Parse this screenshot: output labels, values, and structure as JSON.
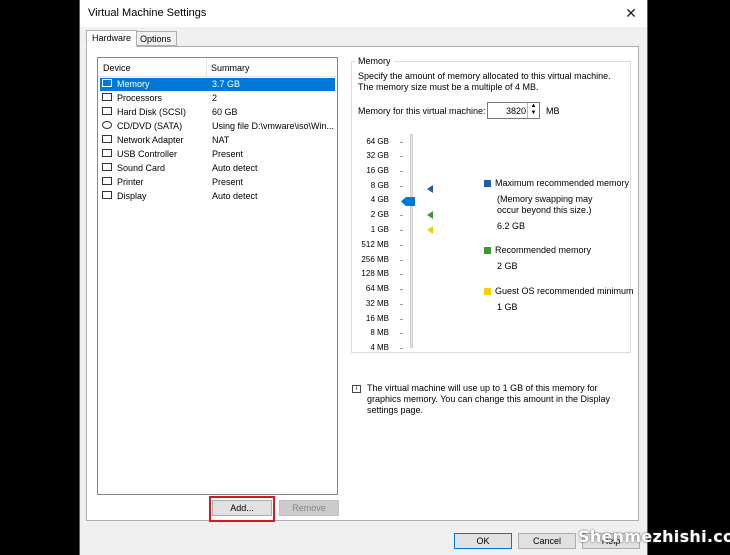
{
  "window": {
    "title": "Virtual Machine Settings"
  },
  "tabs": [
    {
      "label": "Hardware",
      "active": true
    },
    {
      "label": "Options",
      "active": false
    }
  ],
  "devices": {
    "col_device": "Device",
    "col_summary": "Summary",
    "rows": [
      {
        "name": "Memory",
        "summary": "3.7 GB",
        "icon": "memory-icon",
        "selected": true
      },
      {
        "name": "Processors",
        "summary": "2",
        "icon": "processor-icon"
      },
      {
        "name": "Hard Disk (SCSI)",
        "summary": "60 GB",
        "icon": "hard-disk-icon"
      },
      {
        "name": "CD/DVD (SATA)",
        "summary": "Using file D:\\vmware\\iso\\Win...",
        "icon": "cd-dvd-icon"
      },
      {
        "name": "Network Adapter",
        "summary": "NAT",
        "icon": "network-adapter-icon"
      },
      {
        "name": "USB Controller",
        "summary": "Present",
        "icon": "usb-icon"
      },
      {
        "name": "Sound Card",
        "summary": "Auto detect",
        "icon": "sound-card-icon"
      },
      {
        "name": "Printer",
        "summary": "Present",
        "icon": "printer-icon"
      },
      {
        "name": "Display",
        "summary": "Auto detect",
        "icon": "display-icon"
      }
    ],
    "add_label": "Add...",
    "remove_label": "Remove"
  },
  "memory": {
    "group_label": "Memory",
    "description": "Specify the amount of memory allocated to this virtual machine. The memory size must be a multiple of 4 MB.",
    "field_label": "Memory for this virtual machine:",
    "value": "3820",
    "unit": "MB",
    "scale": [
      "64 GB",
      "32 GB",
      "16 GB",
      "8 GB",
      "4 GB",
      "2 GB",
      "1 GB",
      "512 MB",
      "256 MB",
      "128 MB",
      "64 MB",
      "32 MB",
      "16 MB",
      "8 MB",
      "4 MB"
    ],
    "legend": {
      "max_label": "Maximum recommended memory",
      "max_note": "(Memory swapping may occur beyond this size.)",
      "max_value": "6.2 GB",
      "rec_label": "Recommended memory",
      "rec_value": "2 GB",
      "min_label": "Guest OS recommended minimum",
      "min_value": "1 GB"
    },
    "colors": {
      "max": "#1e5fa8",
      "rec": "#3c9a2e",
      "min": "#f2d100",
      "thumb": "#0078d7"
    },
    "info": "The virtual machine will use up to 1 GB of this memory for graphics memory. You can change this amount in the Display settings page."
  },
  "footer": {
    "ok_label": "OK",
    "cancel_label": "Cancel",
    "help_label": "Help"
  },
  "watermark": "Shenmezhishi.com"
}
